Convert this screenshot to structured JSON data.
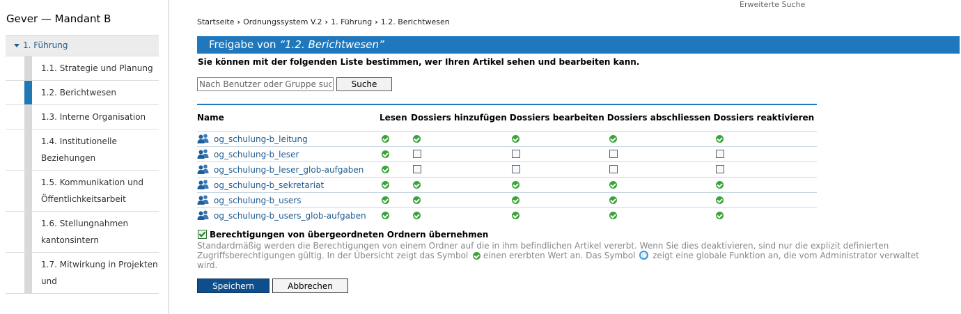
{
  "site": {
    "title": "Gever — Mandant B"
  },
  "top": {
    "advanced_search": "Erweiterte Suche"
  },
  "breadcrumb": [
    "Startseite",
    "Ordnungssystem V.2",
    "1. Führung",
    "1.2. Berichtwesen"
  ],
  "sidebar": {
    "parent": "1. Führung",
    "items": [
      {
        "label": "1.1. Strategie und Planung",
        "active": false
      },
      {
        "label": "1.2. Berichtwesen",
        "active": true
      },
      {
        "label": "1.3. Interne Organisation",
        "active": false
      },
      {
        "label": "1.4. Institutionelle Beziehungen",
        "active": false
      },
      {
        "label": "1.5. Kommunikation und Öffentlichkeitsarbeit",
        "active": false
      },
      {
        "label": "1.6. Stellungnahmen kantonsintern",
        "active": false
      },
      {
        "label": "1.7. Mitwirkung in Projekten und",
        "active": false
      }
    ]
  },
  "page": {
    "title_prefix": "Freigabe von ",
    "title_item": "“1.2. Berichtwesen”",
    "intro": "Sie können mit der folgenden Liste bestimmen, wer Ihren Artikel sehen und bearbeiten kann."
  },
  "search": {
    "placeholder": "Nach Benutzer oder Gruppe suchen",
    "button": "Suche"
  },
  "table": {
    "columns": [
      "Name",
      "Lesen",
      "Dossiers hinzufügen",
      "Dossiers bearbeiten",
      "Dossiers abschliessen",
      "Dossiers reaktivieren"
    ],
    "rows": [
      {
        "name": "og_schulung-b_leitung",
        "perms": [
          "inherited",
          "inherited",
          "inherited",
          "inherited",
          "inherited"
        ]
      },
      {
        "name": "og_schulung-b_leser",
        "perms": [
          "inherited",
          "unchecked",
          "unchecked",
          "unchecked",
          "unchecked"
        ]
      },
      {
        "name": "og_schulung-b_leser_glob-aufgaben",
        "perms": [
          "inherited",
          "unchecked",
          "unchecked",
          "unchecked",
          "unchecked"
        ]
      },
      {
        "name": "og_schulung-b_sekretariat",
        "perms": [
          "inherited",
          "inherited",
          "inherited",
          "inherited",
          "inherited"
        ]
      },
      {
        "name": "og_schulung-b_users",
        "perms": [
          "inherited",
          "inherited",
          "inherited",
          "inherited",
          "inherited"
        ]
      },
      {
        "name": "og_schulung-b_users_glob-aufgaben",
        "perms": [
          "inherited",
          "inherited",
          "inherited",
          "inherited",
          "inherited"
        ]
      }
    ]
  },
  "inherit": {
    "checked": true,
    "label": "Berechtigungen von übergeordneten Ordnern übernehmen",
    "help_1": "Standardmäßig werden die Berechtigungen von einem Ordner auf die in ihm befindlichen Artikel vererbt. Wenn Sie dies deaktivieren, sind nur die explizit definierten Zugriffsberechtigungen gültig. In der Übersicht zeigt das Symbol ",
    "help_2": " einen ererbten Wert an. Das Symbol ",
    "help_3": " zeigt eine globale Funktion an, die vom Administrator verwaltet wird."
  },
  "actions": {
    "save": "Speichern",
    "cancel": "Abbrechen"
  },
  "icons": {
    "group": "group-icon",
    "inherited": "inherited-check-icon",
    "global": "global-role-icon"
  },
  "colors": {
    "accent": "#1f78bd",
    "link": "#205c90",
    "check": "#3aa33a",
    "save_button": "#0f4e8c"
  }
}
